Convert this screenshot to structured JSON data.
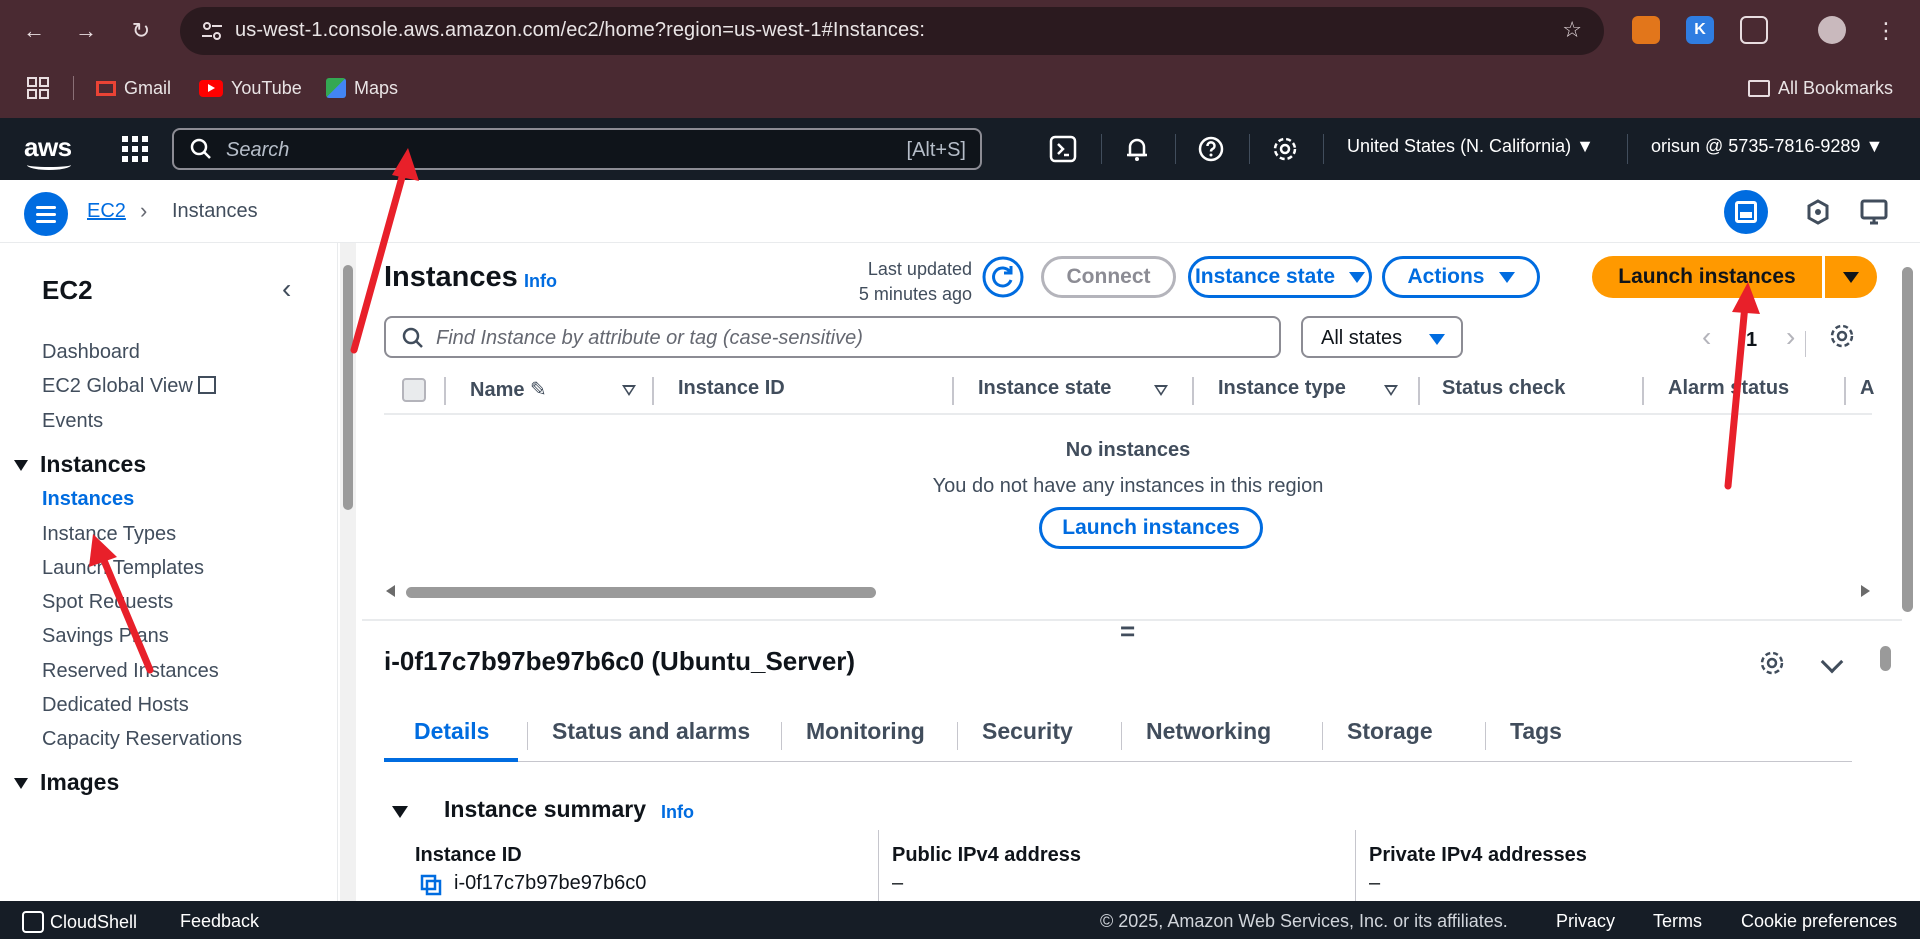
{
  "browser": {
    "url": "us-west-1.console.aws.amazon.com/ec2/home?region=us-west-1#Instances:",
    "bookmarks": [
      {
        "label": "Gmail",
        "icon": "gmail-icon"
      },
      {
        "label": "YouTube",
        "icon": "youtube-icon"
      },
      {
        "label": "Maps",
        "icon": "maps-icon"
      }
    ],
    "all_bookmarks": "All Bookmarks"
  },
  "aws_nav": {
    "logo": "aws",
    "search_placeholder": "Search",
    "search_shortcut": "[Alt+S]",
    "region": "United States (N. California)",
    "account": "orisun @ 5735-7816-9289"
  },
  "breadcrumb": {
    "root": "EC2",
    "current": "Instances"
  },
  "sidebar": {
    "title": "EC2",
    "top_items": [
      "Dashboard",
      "EC2 Global View",
      "Events"
    ],
    "instances_section": "Instances",
    "instances_items": [
      "Instances",
      "Instance Types",
      "Launch Templates",
      "Spot Requests",
      "Savings Plans",
      "Reserved Instances",
      "Dedicated Hosts",
      "Capacity Reservations"
    ],
    "images_section": "Images"
  },
  "main": {
    "title": "Instances",
    "info": "Info",
    "last_updated_label": "Last updated",
    "last_updated_value": "5 minutes ago",
    "connect": "Connect",
    "instance_state": "Instance state",
    "actions": "Actions",
    "launch": "Launch instances",
    "filter_placeholder": "Find Instance by attribute or tag (case-sensitive)",
    "states_filter": "All states",
    "page_number": "1",
    "columns": [
      "Name",
      "Instance ID",
      "Instance state",
      "Instance type",
      "Status check",
      "Alarm status",
      "A"
    ],
    "empty_title": "No instances",
    "empty_sub": "You do not have any instances in this region",
    "empty_button": "Launch instances"
  },
  "detail": {
    "title": "i-0f17c7b97be97b6c0 (Ubuntu_Server)",
    "tabs": [
      "Details",
      "Status and alarms",
      "Monitoring",
      "Security",
      "Networking",
      "Storage",
      "Tags"
    ],
    "active_tab": "Details",
    "summary_title": "Instance summary",
    "summary_info": "Info",
    "fields": [
      {
        "label": "Instance ID",
        "value": "i-0f17c7b97be97b6c0"
      },
      {
        "label": "Public IPv4 address",
        "value": "–"
      },
      {
        "label": "Private IPv4 addresses",
        "value": "–"
      }
    ]
  },
  "footer": {
    "cloudshell": "CloudShell",
    "feedback": "Feedback",
    "copyright": "© 2025, Amazon Web Services, Inc. or its affiliates.",
    "privacy": "Privacy",
    "terms": "Terms",
    "cookies": "Cookie preferences"
  },
  "colors": {
    "aws_nav_bg": "#161d26",
    "link_blue": "#006ce0",
    "launch_orange": "#ff9900",
    "browser_frame": "#4a2a32",
    "annotation_red": "#e8202a"
  }
}
